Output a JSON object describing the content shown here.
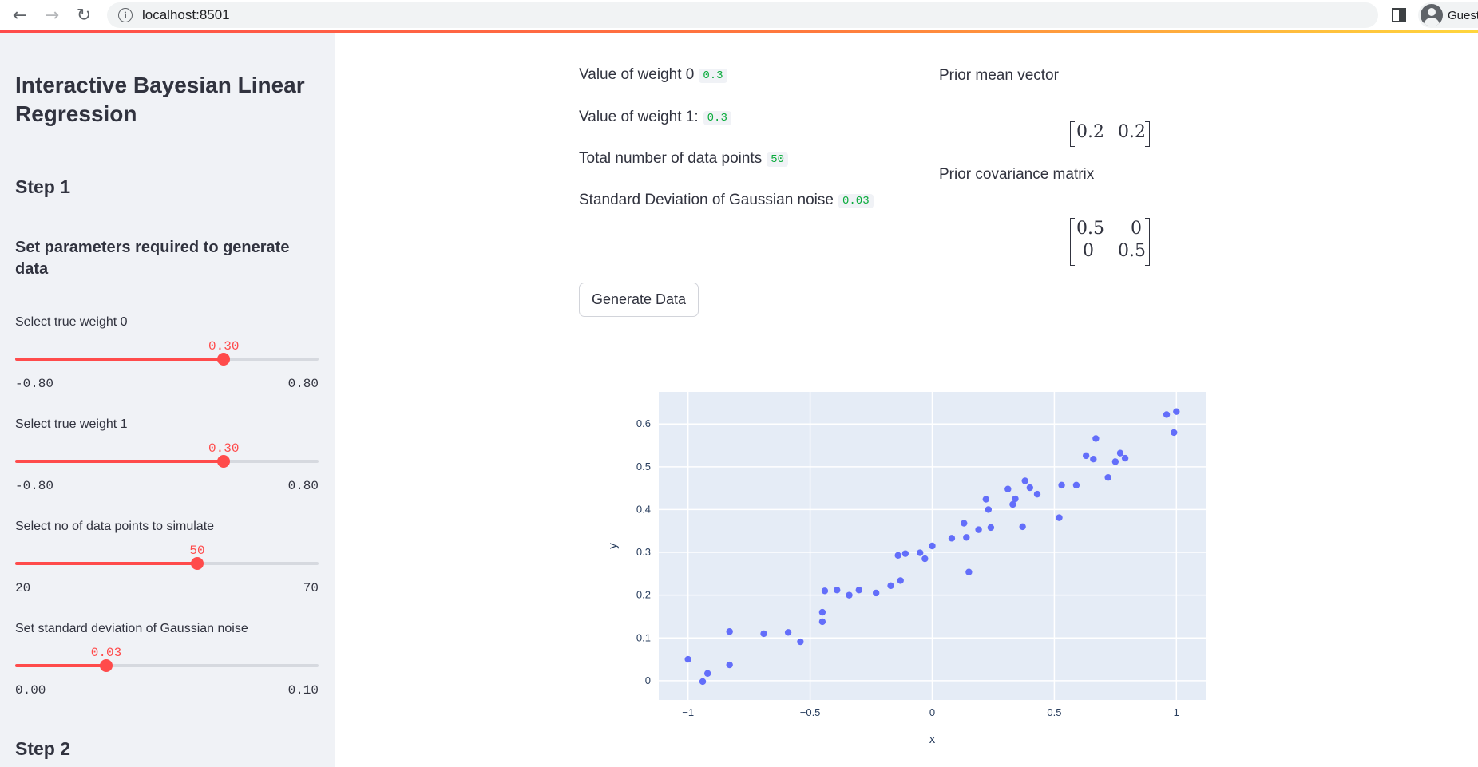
{
  "browser": {
    "url": "localhost:8501",
    "profile_label": "Guest",
    "back_icon": "←",
    "forward_icon": "→",
    "reload_icon": "↻",
    "info_icon": "i"
  },
  "sidebar": {
    "title": "Interactive Bayesian Linear Regression",
    "step1": "Step 1",
    "step1_subtitle": "Set parameters required to generate data",
    "step2": "Step 2",
    "sliders": [
      {
        "label": "Select true weight 0",
        "value": "0.30",
        "min": "-0.80",
        "max": "0.80",
        "fraction": 0.6875
      },
      {
        "label": "Select true weight 1",
        "value": "0.30",
        "min": "-0.80",
        "max": "0.80",
        "fraction": 0.6875
      },
      {
        "label": "Select no of data points to simulate",
        "value": "50",
        "min": "20",
        "max": "70",
        "fraction": 0.6
      },
      {
        "label": "Set standard deviation of Gaussian noise",
        "value": "0.03",
        "min": "0.00",
        "max": "0.10",
        "fraction": 0.3
      }
    ]
  },
  "main": {
    "params": {
      "weight0_label": "Value of weight 0",
      "weight0_value": "0.3",
      "weight1_label": "Value of weight 1:",
      "weight1_value": "0.3",
      "npoints_label": "Total number of data points",
      "npoints_value": "50",
      "noise_label": "Standard Deviation of Gaussian noise",
      "noise_value": "0.03"
    },
    "prior": {
      "mean_label": "Prior mean vector",
      "mean": [
        "0.2",
        "0.2"
      ],
      "cov_label": "Prior covariance matrix",
      "cov": [
        [
          "0.5",
          "0"
        ],
        [
          "0",
          "0.5"
        ]
      ]
    },
    "generate_button": "Generate Data"
  },
  "chart_data": {
    "type": "scatter",
    "title": "",
    "xlabel": "x",
    "ylabel": "y",
    "xlim": [
      -1.12,
      1.12
    ],
    "ylim": [
      -0.045,
      0.675
    ],
    "x_ticks": [
      -1,
      -0.5,
      0,
      0.5,
      1
    ],
    "x_tick_labels": [
      "−1",
      "−0.5",
      "0",
      "0.5",
      "1"
    ],
    "y_ticks": [
      0,
      0.1,
      0.2,
      0.3,
      0.4,
      0.5,
      0.6
    ],
    "y_tick_labels": [
      "0",
      "0.1",
      "0.2",
      "0.3",
      "0.4",
      "0.5",
      "0.6"
    ],
    "grid": true,
    "background": "#e5ecf6",
    "point_color": "#636efa",
    "x": [
      -1.0,
      -0.94,
      -0.92,
      -0.83,
      -0.83,
      -0.69,
      -0.59,
      -0.54,
      -0.45,
      -0.45,
      -0.44,
      -0.39,
      -0.34,
      -0.3,
      -0.23,
      -0.17,
      -0.14,
      -0.13,
      -0.11,
      -0.05,
      -0.03,
      0.0,
      0.08,
      0.13,
      0.14,
      0.15,
      0.19,
      0.22,
      0.23,
      0.24,
      0.31,
      0.33,
      0.34,
      0.37,
      0.38,
      0.4,
      0.43,
      0.52,
      0.53,
      0.59,
      0.63,
      0.66,
      0.67,
      0.72,
      0.75,
      0.77,
      0.79,
      0.96,
      0.99,
      1.0
    ],
    "y": [
      0.05,
      -0.002,
      0.017,
      0.037,
      0.115,
      0.11,
      0.113,
      0.091,
      0.138,
      0.16,
      0.21,
      0.212,
      0.2,
      0.212,
      0.205,
      0.222,
      0.293,
      0.234,
      0.297,
      0.299,
      0.285,
      0.315,
      0.333,
      0.368,
      0.335,
      0.254,
      0.353,
      0.424,
      0.4,
      0.358,
      0.448,
      0.412,
      0.425,
      0.36,
      0.467,
      0.451,
      0.436,
      0.381,
      0.457,
      0.457,
      0.526,
      0.518,
      0.566,
      0.475,
      0.512,
      0.532,
      0.52,
      0.622,
      0.58,
      0.629
    ]
  }
}
